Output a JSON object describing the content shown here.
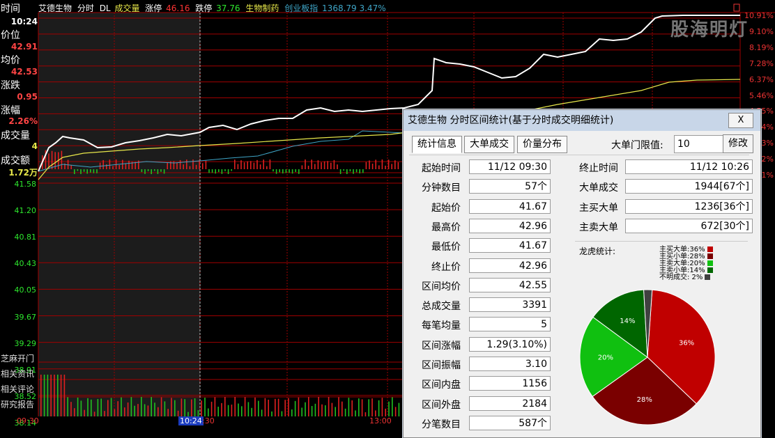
{
  "header": {
    "stock_name": "艾德生物",
    "mode": "分时",
    "dl": "DL",
    "volume_label": "成交量",
    "limit_up_label": "涨停",
    "limit_up_value": "46.16",
    "limit_down_label": "跌停",
    "limit_down_value": "37.76",
    "sector": "生物制药",
    "index_name": "创业板指",
    "index_value": "1368.79 3.47%"
  },
  "left_panel": {
    "time_label": "时间",
    "time_value": "10:24",
    "price_label": "价位",
    "price_value": "42.91",
    "avg_label": "均价",
    "avg_value": "42.53",
    "change_label": "涨跌",
    "change_value": "0.95",
    "pct_label": "涨幅",
    "pct_value": "2.26%",
    "vol_label": "成交量",
    "vol_value": "4",
    "amount_label": "成交额",
    "amount_value": "1.72万"
  },
  "y_ticks_green": [
    "41.58",
    "41.20",
    "40.81",
    "40.43",
    "40.05",
    "39.67",
    "39.29",
    "38.91",
    "38.52",
    "38.14"
  ],
  "y_ticks_right": [
    "10.91%",
    "9.10%",
    "8.19%",
    "7.28%",
    "6.37%",
    "5.46%",
    "4.55%",
    "3.64%",
    "2.73%",
    "1.82%",
    "0.91%"
  ],
  "links": [
    "芝麻开门",
    "相关资讯",
    "相关评论",
    "研究报告"
  ],
  "x_labels": [
    "09:30",
    "10:24",
    "13:00"
  ],
  "watermark": "股海明灯",
  "colors": {
    "price_line": "#ffffff",
    "avg_line": "#e8e84a",
    "vol_up": "#e02020",
    "vol_down": "#20c020",
    "grid": "#9b0000",
    "index_line": "#3fa6c8"
  },
  "dialog": {
    "title": "艾德生物 分时区间统计(基于分时成交明细统计)",
    "close_label": "X",
    "tabs": [
      "统计信息",
      "大单成交",
      "价量分布"
    ],
    "threshold_label": "大单门限值:",
    "threshold_value": "10",
    "modify_label": "修改",
    "left_fields": [
      {
        "label": "起始时间",
        "value": "11/12 09:30"
      },
      {
        "label": "分钟数目",
        "value": "57个"
      },
      {
        "label": "起始价",
        "value": "41.67"
      },
      {
        "label": "最高价",
        "value": "42.96"
      },
      {
        "label": "最低价",
        "value": "41.67"
      },
      {
        "label": "终止价",
        "value": "42.96"
      },
      {
        "label": "区间均价",
        "value": "42.55"
      },
      {
        "label": "总成交量",
        "value": "3391"
      },
      {
        "label": "每笔均量",
        "value": "5"
      },
      {
        "label": "区间涨幅",
        "value": "1.29(3.10%)"
      },
      {
        "label": "区间振幅",
        "value": "3.10"
      },
      {
        "label": "区间内盘",
        "value": "1156"
      },
      {
        "label": "区间外盘",
        "value": "2184"
      },
      {
        "label": "分笔数目",
        "value": "587个"
      }
    ],
    "right_fields": [
      {
        "label": "终止时间",
        "value": "11/12 10:26"
      },
      {
        "label": "大单成交",
        "value": "1944[67个]"
      },
      {
        "label": "主买大单",
        "value": "1236[36个]"
      },
      {
        "label": "主卖大单",
        "value": "672[30个]"
      }
    ],
    "pie_title": "龙虎统计:",
    "pie": [
      {
        "label": "主买大单:36%",
        "slice_label": "36%",
        "value": 36,
        "color": "#c00000"
      },
      {
        "label": "主买小单:28%",
        "slice_label": "28%",
        "value": 28,
        "color": "#7a0000"
      },
      {
        "label": "主卖大单:20%",
        "slice_label": "20%",
        "value": 20,
        "color": "#10c010"
      },
      {
        "label": "主卖小单:14%",
        "slice_label": "14%",
        "value": 14,
        "color": "#006600"
      },
      {
        "label": "不明成交: 2%",
        "slice_label": "",
        "value": 2,
        "color": "#404040"
      }
    ]
  }
}
